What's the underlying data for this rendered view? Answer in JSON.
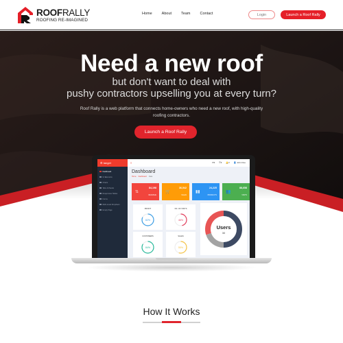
{
  "brand": {
    "name_bold": "ROOF",
    "name_light": "RALLY",
    "tagline": "ROOFING RE-IMAGINED",
    "accent_color": "#e51f28"
  },
  "nav": {
    "items": [
      "Home",
      "About",
      "Team",
      "Contact"
    ],
    "login_label": "Login",
    "launch_label": "Launch a Roof Rally"
  },
  "hero": {
    "headline": "Need a new roof",
    "subline_1": "but don't want to deal with",
    "subline_2": "pushy contractors upselling you at every turn?",
    "description": "Roof Rally is a web platform that connects home-owners who need a new roof, with high-quality roofing contractors.",
    "cta_label": "Launch a Roof Rally"
  },
  "dashboard": {
    "brand": "tanget",
    "title": "Dashboard",
    "breadcrumb": [
      "Home",
      "Dashboard",
      "Data"
    ],
    "user": "John Doe",
    "sidebar": [
      "Dashboard",
      "UI Elements",
      "Charts",
      "Tabs & Panels",
      "Responsive Tables",
      "Forms",
      "Multi-Level Dropdown",
      "Empty Page"
    ],
    "stats": [
      {
        "value": "84,198",
        "label": "REVENUE",
        "color": "#f2453d",
        "icon": "exchange-icon"
      },
      {
        "value": "36,542",
        "label": "SALES",
        "color": "#ff9c07",
        "icon": "cart-icon"
      },
      {
        "value": "24,225",
        "label": "PRODUCTS",
        "color": "#2d94f3",
        "icon": "bar-chart-icon"
      },
      {
        "value": "88,658",
        "label": "VISITS",
        "color": "#4caf50",
        "icon": "users-icon"
      }
    ],
    "gauges": [
      {
        "label": "PROFIT",
        "percent": 82,
        "color": "#3c9ee5"
      },
      {
        "label": "NO. OF VISITS",
        "percent": 46,
        "color": "#e23c5a"
      },
      {
        "label": "CUSTOMERS",
        "percent": 84,
        "color": "#26b99a"
      },
      {
        "label": "SALES",
        "percent": 55,
        "color": "#f6c343"
      }
    ],
    "donut": {
      "title": "Users",
      "value": "30",
      "segments": [
        {
          "name": "dark",
          "value": 50,
          "color": "#3d4a63"
        },
        {
          "name": "gray",
          "value": 20,
          "color": "#a3a3a3"
        },
        {
          "name": "red",
          "value": 30,
          "color": "#e85555"
        }
      ]
    }
  },
  "section": {
    "title": "How It Works"
  }
}
